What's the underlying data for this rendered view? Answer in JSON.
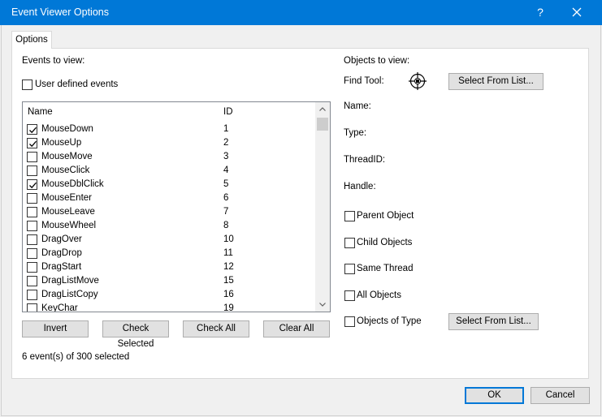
{
  "window": {
    "title": "Event Viewer Options",
    "help_label": "?"
  },
  "tabs": [
    {
      "label": "Options"
    }
  ],
  "events": {
    "section_label": "Events to view:",
    "user_defined_label": "User defined events",
    "user_defined_checked": false,
    "columns": {
      "name": "Name",
      "id": "ID"
    },
    "rows": [
      {
        "name": "MouseDown",
        "id": "1",
        "checked": true
      },
      {
        "name": "MouseUp",
        "id": "2",
        "checked": true
      },
      {
        "name": "MouseMove",
        "id": "3",
        "checked": false
      },
      {
        "name": "MouseClick",
        "id": "4",
        "checked": false
      },
      {
        "name": "MouseDblClick",
        "id": "5",
        "checked": true
      },
      {
        "name": "MouseEnter",
        "id": "6",
        "checked": false
      },
      {
        "name": "MouseLeave",
        "id": "7",
        "checked": false
      },
      {
        "name": "MouseWheel",
        "id": "8",
        "checked": false
      },
      {
        "name": "DragOver",
        "id": "10",
        "checked": false
      },
      {
        "name": "DragDrop",
        "id": "11",
        "checked": false
      },
      {
        "name": "DragStart",
        "id": "12",
        "checked": false
      },
      {
        "name": "DragListMove",
        "id": "15",
        "checked": false
      },
      {
        "name": "DragListCopy",
        "id": "16",
        "checked": false
      },
      {
        "name": "KeyChar",
        "id": "19",
        "checked": false
      }
    ],
    "buttons": {
      "invert": "Invert",
      "check_selected": "Check Selected",
      "check_all": "Check All",
      "clear_all": "Clear All"
    },
    "status": "6 event(s) of 300 selected"
  },
  "objects": {
    "section_label": "Objects to view:",
    "find_tool_label": "Find Tool:",
    "select_from_list_label": "Select From List...",
    "name_label": "Name:",
    "type_label": "Type:",
    "thread_label": "ThreadID:",
    "handle_label": "Handle:",
    "options": [
      {
        "label": "Parent Object",
        "checked": false
      },
      {
        "label": "Child Objects",
        "checked": false
      },
      {
        "label": "Same Thread",
        "checked": false
      },
      {
        "label": "All Objects",
        "checked": false
      },
      {
        "label": "Objects of Type",
        "checked": false
      }
    ],
    "type_select_label": "Select From List..."
  },
  "footer": {
    "ok_label": "OK",
    "cancel_label": "Cancel"
  },
  "colors": {
    "titlebar": "#0078d7",
    "default_button_border": "#0078d7"
  }
}
